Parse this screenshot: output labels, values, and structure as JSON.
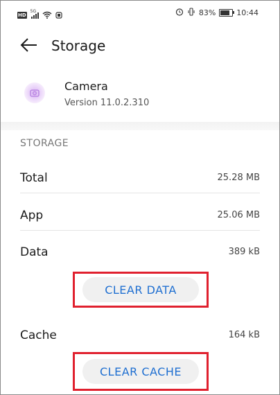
{
  "status_bar": {
    "network": "HD",
    "signal_type": "5G",
    "battery_percent": "83%",
    "time": "10:44",
    "battery_level": 0.83
  },
  "header": {
    "title": "Storage"
  },
  "app": {
    "name": "Camera",
    "version": "Version 11.0.2.310"
  },
  "storage": {
    "section_title": "STORAGE",
    "rows": [
      {
        "label": "Total",
        "value": "25.28 MB"
      },
      {
        "label": "App",
        "value": "25.06 MB"
      },
      {
        "label": "Data",
        "value": "389 kB"
      },
      {
        "label": "Cache",
        "value": "164 kB"
      }
    ],
    "clear_data_label": "CLEAR DATA",
    "clear_cache_label": "CLEAR CACHE"
  },
  "colors": {
    "accent": "#1f6fd1",
    "highlight": "#e0202e"
  }
}
